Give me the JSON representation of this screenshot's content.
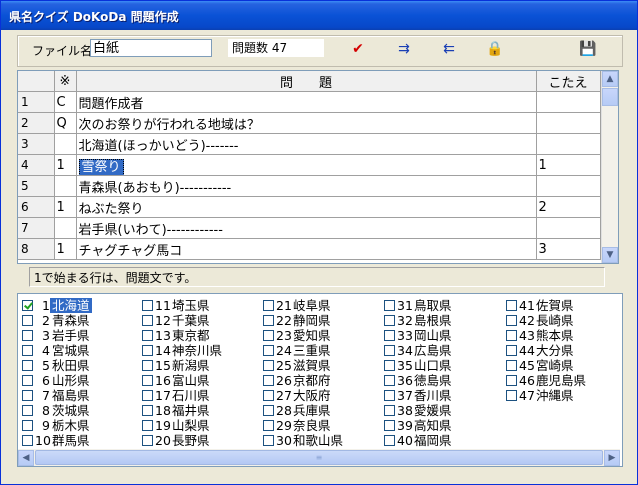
{
  "window": {
    "title": "県名クイズ DoKoDa 問題作成"
  },
  "toolbar": {
    "file_label": "ファイル名",
    "file_value": "白紙",
    "count_text": "問題数 47",
    "buttons": [
      {
        "name": "check-icon",
        "glyph": "✔",
        "color": "#d40000"
      },
      {
        "name": "insert-row-icon",
        "glyph": "⇉",
        "color": "#1a3fb4"
      },
      {
        "name": "delete-row-icon",
        "glyph": "⇇",
        "color": "#1a3fb4"
      },
      {
        "name": "lock-icon",
        "glyph": "🔒",
        "color": "#444444"
      },
      {
        "name": "save-disk-icon",
        "glyph": "💾",
        "color": "#444444"
      }
    ]
  },
  "grid": {
    "headers": [
      "",
      "※",
      "問　　題",
      "こたえ"
    ],
    "rows": [
      {
        "num": "1",
        "mark": "C",
        "question": "問題作成者",
        "answer": ""
      },
      {
        "num": "2",
        "mark": "Q",
        "question": "次のお祭りが行われる地域は？",
        "answer": ""
      },
      {
        "num": "3",
        "mark": "",
        "question": "北海道(ほっかいどう)-------",
        "answer": ""
      },
      {
        "num": "4",
        "mark": "1",
        "question": "雪祭り",
        "answer": "1"
      },
      {
        "num": "5",
        "mark": "",
        "question": "青森県(あおもり)-----------",
        "answer": ""
      },
      {
        "num": "6",
        "mark": "1",
        "question": "ねぶた祭り",
        "answer": "2"
      },
      {
        "num": "7",
        "mark": "",
        "question": "岩手県(いわて)------------",
        "answer": ""
      },
      {
        "num": "8",
        "mark": "1",
        "question": "チャグチャグ馬コ",
        "answer": "3"
      }
    ]
  },
  "status": "1で始まる行は、問題文です。",
  "prefectures": [
    {
      "n": "1",
      "name": "北海道",
      "checked": true
    },
    {
      "n": "2",
      "name": "青森県",
      "checked": false
    },
    {
      "n": "3",
      "name": "岩手県",
      "checked": false
    },
    {
      "n": "4",
      "name": "宮城県",
      "checked": false
    },
    {
      "n": "5",
      "name": "秋田県",
      "checked": false
    },
    {
      "n": "6",
      "name": "山形県",
      "checked": false
    },
    {
      "n": "7",
      "name": "福島県",
      "checked": false
    },
    {
      "n": "8",
      "name": "茨城県",
      "checked": false
    },
    {
      "n": "9",
      "name": "栃木県",
      "checked": false
    },
    {
      "n": "10",
      "name": "群馬県",
      "checked": false
    },
    {
      "n": "11",
      "name": "埼玉県",
      "checked": false
    },
    {
      "n": "12",
      "name": "千葉県",
      "checked": false
    },
    {
      "n": "13",
      "name": "東京都",
      "checked": false
    },
    {
      "n": "14",
      "name": "神奈川県",
      "checked": false
    },
    {
      "n": "15",
      "name": "新潟県",
      "checked": false
    },
    {
      "n": "16",
      "name": "富山県",
      "checked": false
    },
    {
      "n": "17",
      "name": "石川県",
      "checked": false
    },
    {
      "n": "18",
      "name": "福井県",
      "checked": false
    },
    {
      "n": "19",
      "name": "山梨県",
      "checked": false
    },
    {
      "n": "20",
      "name": "長野県",
      "checked": false
    },
    {
      "n": "21",
      "name": "岐阜県",
      "checked": false
    },
    {
      "n": "22",
      "name": "静岡県",
      "checked": false
    },
    {
      "n": "23",
      "name": "愛知県",
      "checked": false
    },
    {
      "n": "24",
      "name": "三重県",
      "checked": false
    },
    {
      "n": "25",
      "name": "滋賀県",
      "checked": false
    },
    {
      "n": "26",
      "name": "京都府",
      "checked": false
    },
    {
      "n": "27",
      "name": "大阪府",
      "checked": false
    },
    {
      "n": "28",
      "name": "兵庫県",
      "checked": false
    },
    {
      "n": "29",
      "name": "奈良県",
      "checked": false
    },
    {
      "n": "30",
      "name": "和歌山県",
      "checked": false
    },
    {
      "n": "31",
      "name": "鳥取県",
      "checked": false
    },
    {
      "n": "32",
      "name": "島根県",
      "checked": false
    },
    {
      "n": "33",
      "name": "岡山県",
      "checked": false
    },
    {
      "n": "34",
      "name": "広島県",
      "checked": false
    },
    {
      "n": "35",
      "name": "山口県",
      "checked": false
    },
    {
      "n": "36",
      "name": "徳島県",
      "checked": false
    },
    {
      "n": "37",
      "name": "香川県",
      "checked": false
    },
    {
      "n": "38",
      "name": "愛媛県",
      "checked": false
    },
    {
      "n": "39",
      "name": "高知県",
      "checked": false
    },
    {
      "n": "40",
      "name": "福岡県",
      "checked": false
    },
    {
      "n": "41",
      "name": "佐賀県",
      "checked": false
    },
    {
      "n": "42",
      "name": "長崎県",
      "checked": false
    },
    {
      "n": "43",
      "name": "熊本県",
      "checked": false
    },
    {
      "n": "44",
      "name": "大分県",
      "checked": false
    },
    {
      "n": "45",
      "name": "宮崎県",
      "checked": false
    },
    {
      "n": "46",
      "name": "鹿児島県",
      "checked": false
    },
    {
      "n": "47",
      "name": "沖縄県",
      "checked": false
    }
  ]
}
